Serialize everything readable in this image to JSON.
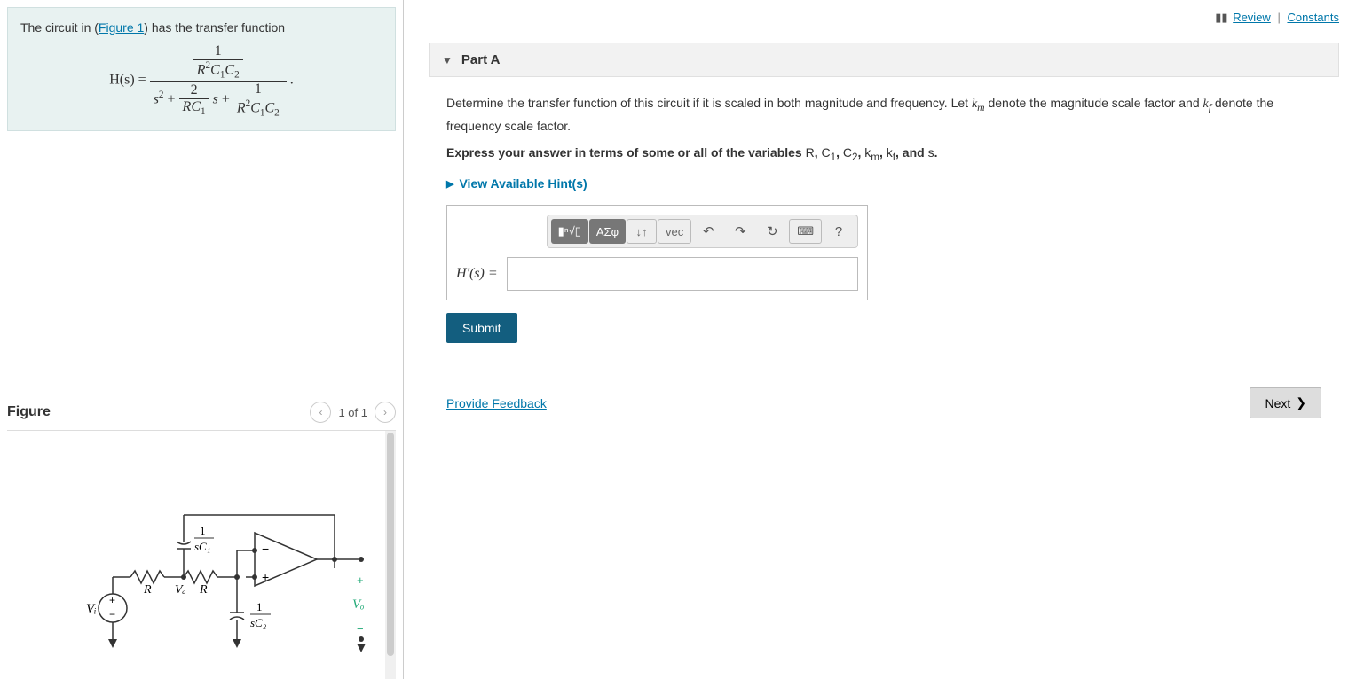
{
  "left": {
    "problem_intro_pre": "The circuit in (",
    "figure_link": "Figure 1",
    "problem_intro_post": ") has the transfer function",
    "equation": {
      "lhs": "H(s) =",
      "num": "1",
      "num_den": "R²C₁C₂",
      "den_term1": "s² +",
      "den_frac_num": "2",
      "den_frac_den": "RC₁",
      "den_mid": "s +",
      "den_frac2_num": "1",
      "den_frac2_den": "R²C₁C₂",
      "trail": "."
    },
    "figure_title": "Figure",
    "figure_count": "1 of 1",
    "circuit_labels": {
      "vi": "Vᵢ",
      "va": "Vₐ",
      "vo": "Vₒ",
      "r1": "R",
      "r2": "R",
      "c1_num": "1",
      "c1_den": "sC₁",
      "c2_num": "1",
      "c2_den": "sC₂",
      "plus": "+",
      "minus": "−"
    }
  },
  "right": {
    "review_link": "Review",
    "constants_link": "Constants",
    "part_title": "Part A",
    "instruction_main": "Determine the transfer function of this circuit if it is scaled in both magnitude and frequency. Let kₘ denote the magnitude scale factor and k_f denote the frequency scale factor.",
    "instruction_bold": "Express your answer in terms of some or all of the variables R, C₁, C₂, kₘ, k_f, and s.",
    "hints_label": "View Available Hint(s)",
    "toolbar": {
      "templates": "▮ⁿ√▯",
      "greek": "ΑΣφ",
      "subsup": "↓↑",
      "vec": "vec",
      "undo": "↶",
      "redo": "↷",
      "reset": "↻",
      "keyboard": "⌨",
      "help": "?"
    },
    "answer_label": "H'(s) =",
    "submit_label": "Submit",
    "feedback_label": "Provide Feedback",
    "next_label": "Next"
  }
}
